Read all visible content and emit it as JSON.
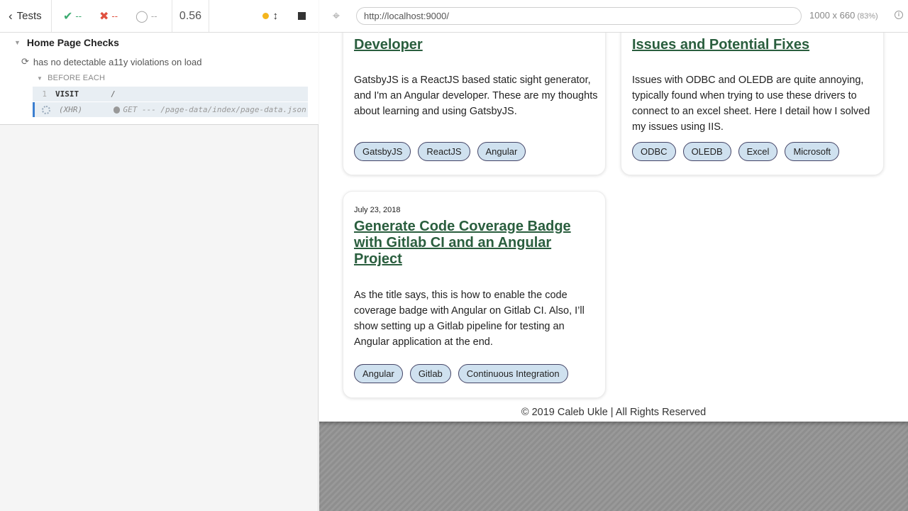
{
  "reporter": {
    "tests_label": "Tests",
    "passed": "--",
    "failed": "--",
    "pending": "--",
    "duration": "0.56",
    "suite_title": "Home Page Checks",
    "test_title": "has no detectable a11y violations on load",
    "hook_label": "BEFORE EACH",
    "commands": [
      {
        "num": "1",
        "name": "VISIT",
        "message": "/"
      },
      {
        "num": "",
        "name": "(XHR)",
        "message": "GET --- /page-data/index/page-data.json"
      }
    ]
  },
  "aut": {
    "url": "http://localhost:9000/",
    "viewport": "1000 x 660",
    "zoom": "(83%)",
    "posts": [
      {
        "title": "Developer",
        "body": "GatsbyJS is a ReactJS based static sight generator, and I'm an Angular developer. These are my thoughts about learning and using GatsbyJS.",
        "tags": [
          "GatsbyJS",
          "ReactJS",
          "Angular"
        ]
      },
      {
        "title": "Issues and Potential Fixes",
        "body": "Issues with ODBC and OLEDB are quite annoying, typically found when trying to use these drivers to connect to an excel sheet. Here I detail how I solved my issues using IIS.",
        "tags": [
          "ODBC",
          "OLEDB",
          "Excel",
          "Microsoft"
        ]
      },
      {
        "date": "July 23, 2018",
        "title": "Generate Code Coverage Badge with Gitlab CI and an Angular Project",
        "body": "As the title says, this is how to enable the code coverage badge with Angular on Gitlab CI. Also, I’ll show setting up a Gitlab pipeline for testing an Angular application at the end.",
        "tags": [
          "Angular",
          "Gitlab",
          "Continuous Integration"
        ]
      }
    ],
    "footer": "© 2019 Caleb Ukle | All Rights Reserved"
  }
}
